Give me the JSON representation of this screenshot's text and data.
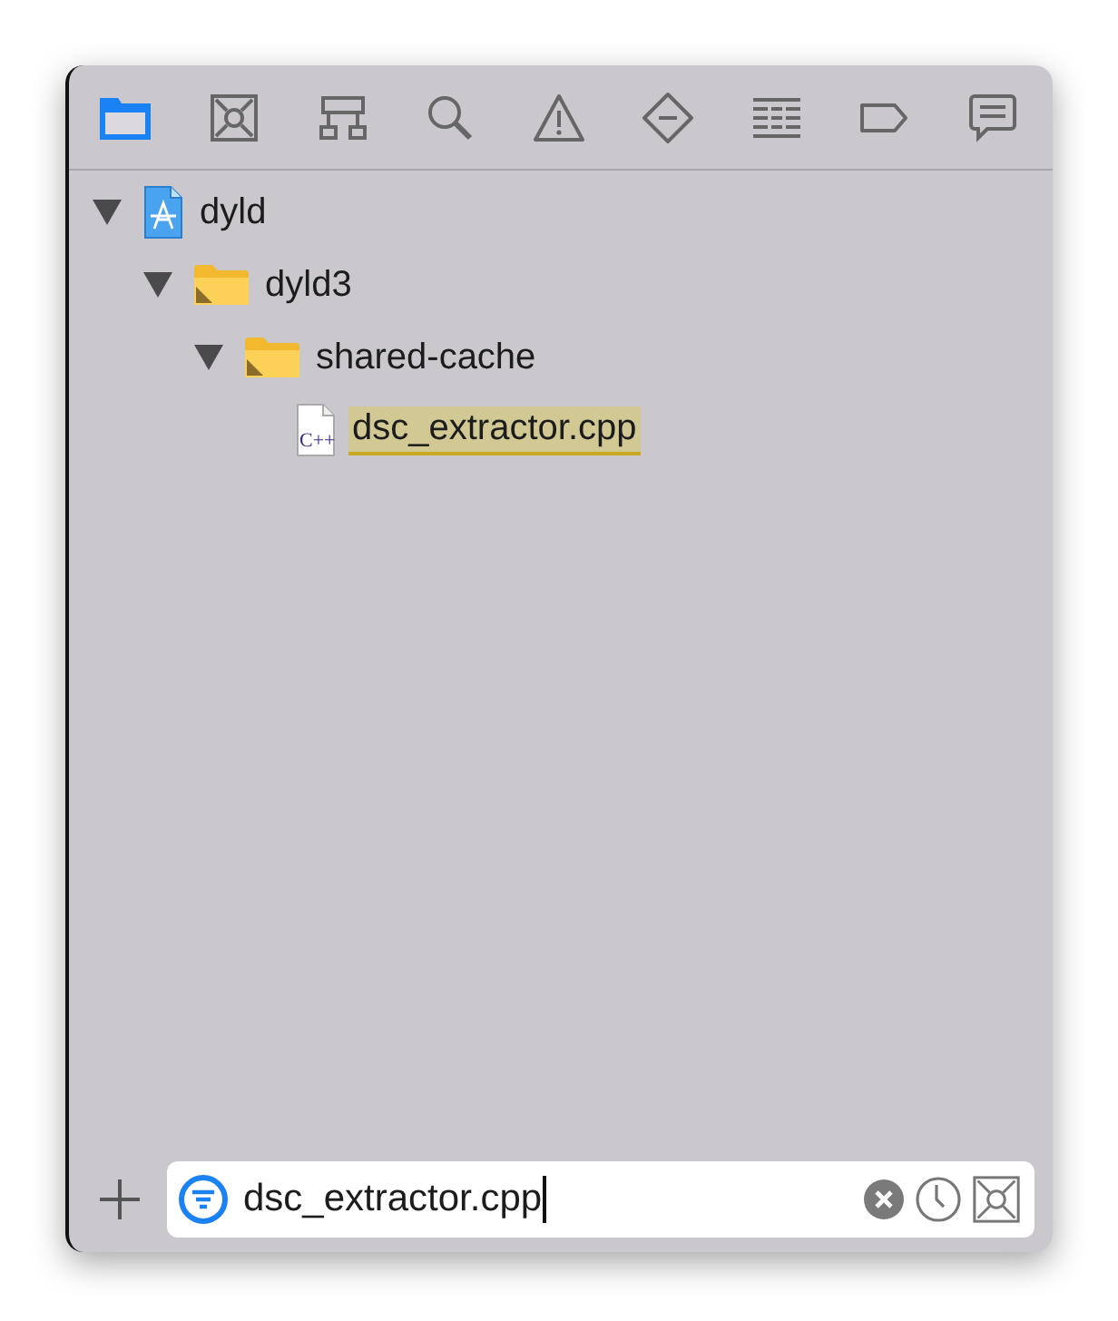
{
  "tabs": [
    {
      "selected": true
    },
    {
      "selected": false
    },
    {
      "selected": false
    },
    {
      "selected": false
    },
    {
      "selected": false
    },
    {
      "selected": false
    },
    {
      "selected": false
    },
    {
      "selected": false
    },
    {
      "selected": false
    }
  ],
  "tree": [
    {
      "label": "dyld",
      "kind": "project",
      "expanded": true,
      "children": [
        {
          "label": "dyld3",
          "kind": "folder",
          "expanded": true,
          "children": [
            {
              "label": "shared-cache",
              "kind": "folder",
              "expanded": true,
              "children": [
                {
                  "label": "dsc_extractor.cpp",
                  "kind": "cpp",
                  "icon_text": "C++",
                  "highlighted": true
                }
              ]
            }
          ]
        }
      ]
    }
  ],
  "filter": {
    "value": "dsc_extractor.cpp"
  }
}
